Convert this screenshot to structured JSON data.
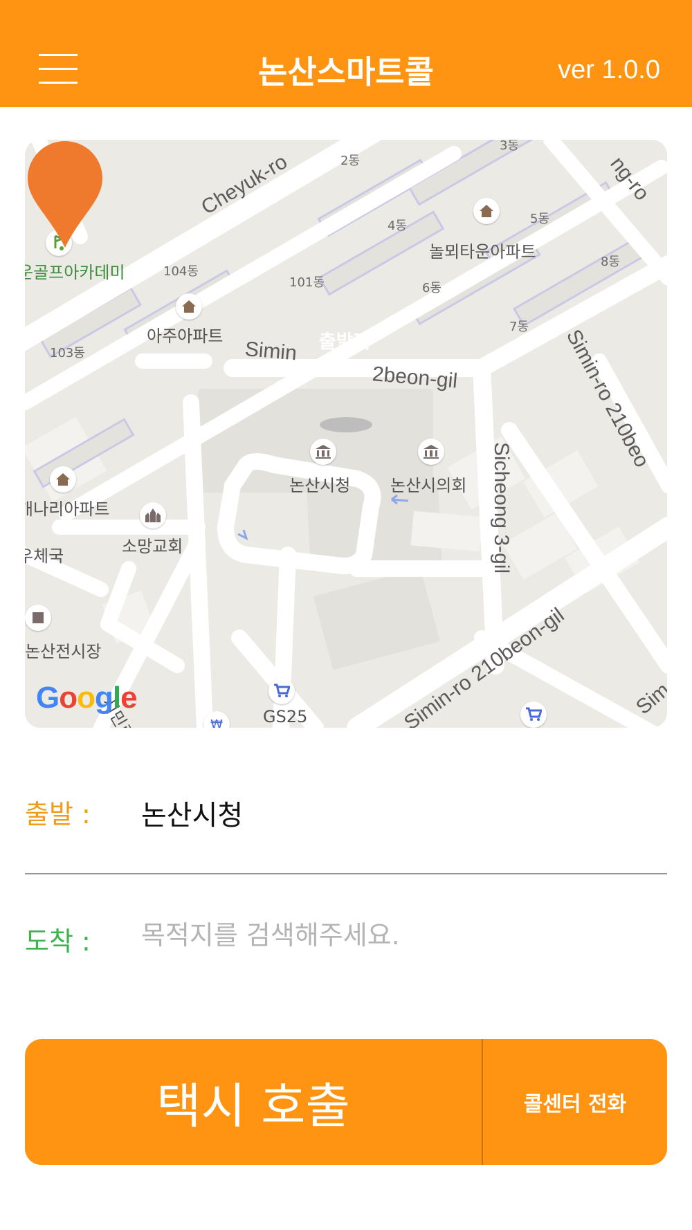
{
  "header": {
    "title": "논산스마트콜",
    "version": "ver 1.0.0",
    "menu_icon": "hamburger-menu-icon",
    "background_color": "#FF9412"
  },
  "map": {
    "provider_logo": "Google",
    "marker": {
      "label": "출발지",
      "color": "#EF7A2E",
      "icon": "map-pin-icon"
    },
    "roads": [
      "Cheyuk-ro",
      "Simin",
      "2beon-gil",
      "Simin-ro 210beo",
      "Sicheong 3-gil",
      "Simin-ro 210beon-gil",
      "Sim",
      "ng-ro"
    ],
    "places": [
      {
        "name": "놀뫼타운아파트",
        "icon": "home-icon"
      },
      {
        "name": "아주아파트",
        "icon": "home-icon"
      },
      {
        "name": "개나리아파트",
        "icon": "home-icon"
      },
      {
        "name": "논산시청",
        "icon": "government-building-icon"
      },
      {
        "name": "논산시의회",
        "icon": "government-building-icon"
      },
      {
        "name": "소망교회",
        "icon": "church-icon"
      },
      {
        "name": "논산전시장",
        "icon": "market-icon"
      },
      {
        "name": "GS25",
        "icon": "shopping-cart-icon"
      },
      {
        "name": "운골프아카데미",
        "icon": "golf-icon"
      },
      {
        "name": "우체국"
      }
    ],
    "blocks": [
      "2동",
      "3동",
      "4동",
      "5동",
      "6동",
      "7동",
      "8동",
      "101동",
      "103동",
      "104동"
    ],
    "partial_labels": [
      "시민로"
    ]
  },
  "form": {
    "departure": {
      "label": "출발 :",
      "value": "논산시청",
      "label_color": "#F29A19"
    },
    "arrival": {
      "label": "도착 :",
      "placeholder": "목적지를 검색해주세요.",
      "value": "",
      "label_color": "#3BB54A"
    }
  },
  "actions": {
    "call_taxi_label": "택시 호출",
    "call_center_label": "콜센터 전화",
    "button_color": "#FF9412"
  }
}
